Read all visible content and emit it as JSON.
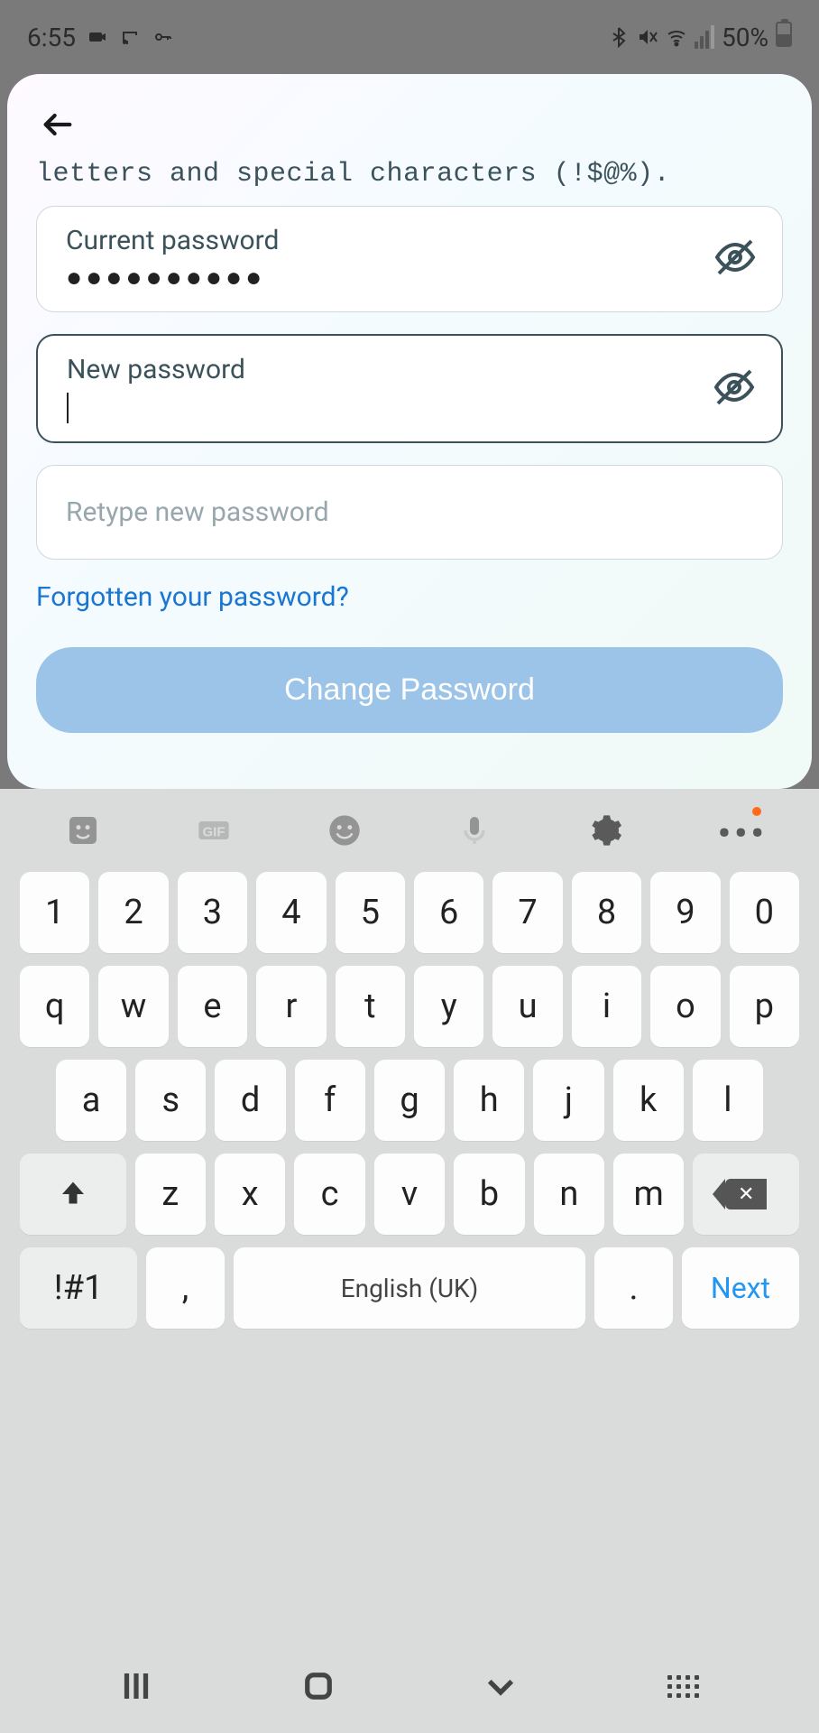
{
  "status": {
    "time": "6:55",
    "battery_pct": "50%"
  },
  "form": {
    "help_text": "letters and special characters (!$@%).",
    "current_label": "Current password",
    "current_value": "●●●●●●●●●●",
    "new_label": "New password",
    "new_value": "",
    "retype_placeholder": "Retype new password",
    "forgot_link": "Forgotten your password?",
    "submit_label": "Change Password"
  },
  "keyboard": {
    "row_num": [
      "1",
      "2",
      "3",
      "4",
      "5",
      "6",
      "7",
      "8",
      "9",
      "0"
    ],
    "row_q": [
      "q",
      "w",
      "e",
      "r",
      "t",
      "y",
      "u",
      "i",
      "o",
      "p"
    ],
    "row_a": [
      "a",
      "s",
      "d",
      "f",
      "g",
      "h",
      "j",
      "k",
      "l"
    ],
    "row_z": [
      "z",
      "x",
      "c",
      "v",
      "b",
      "n",
      "m"
    ],
    "sym_key": "!#1",
    "comma_key": ",",
    "space_label": "English (UK)",
    "dot_key": ".",
    "next_label": "Next"
  }
}
